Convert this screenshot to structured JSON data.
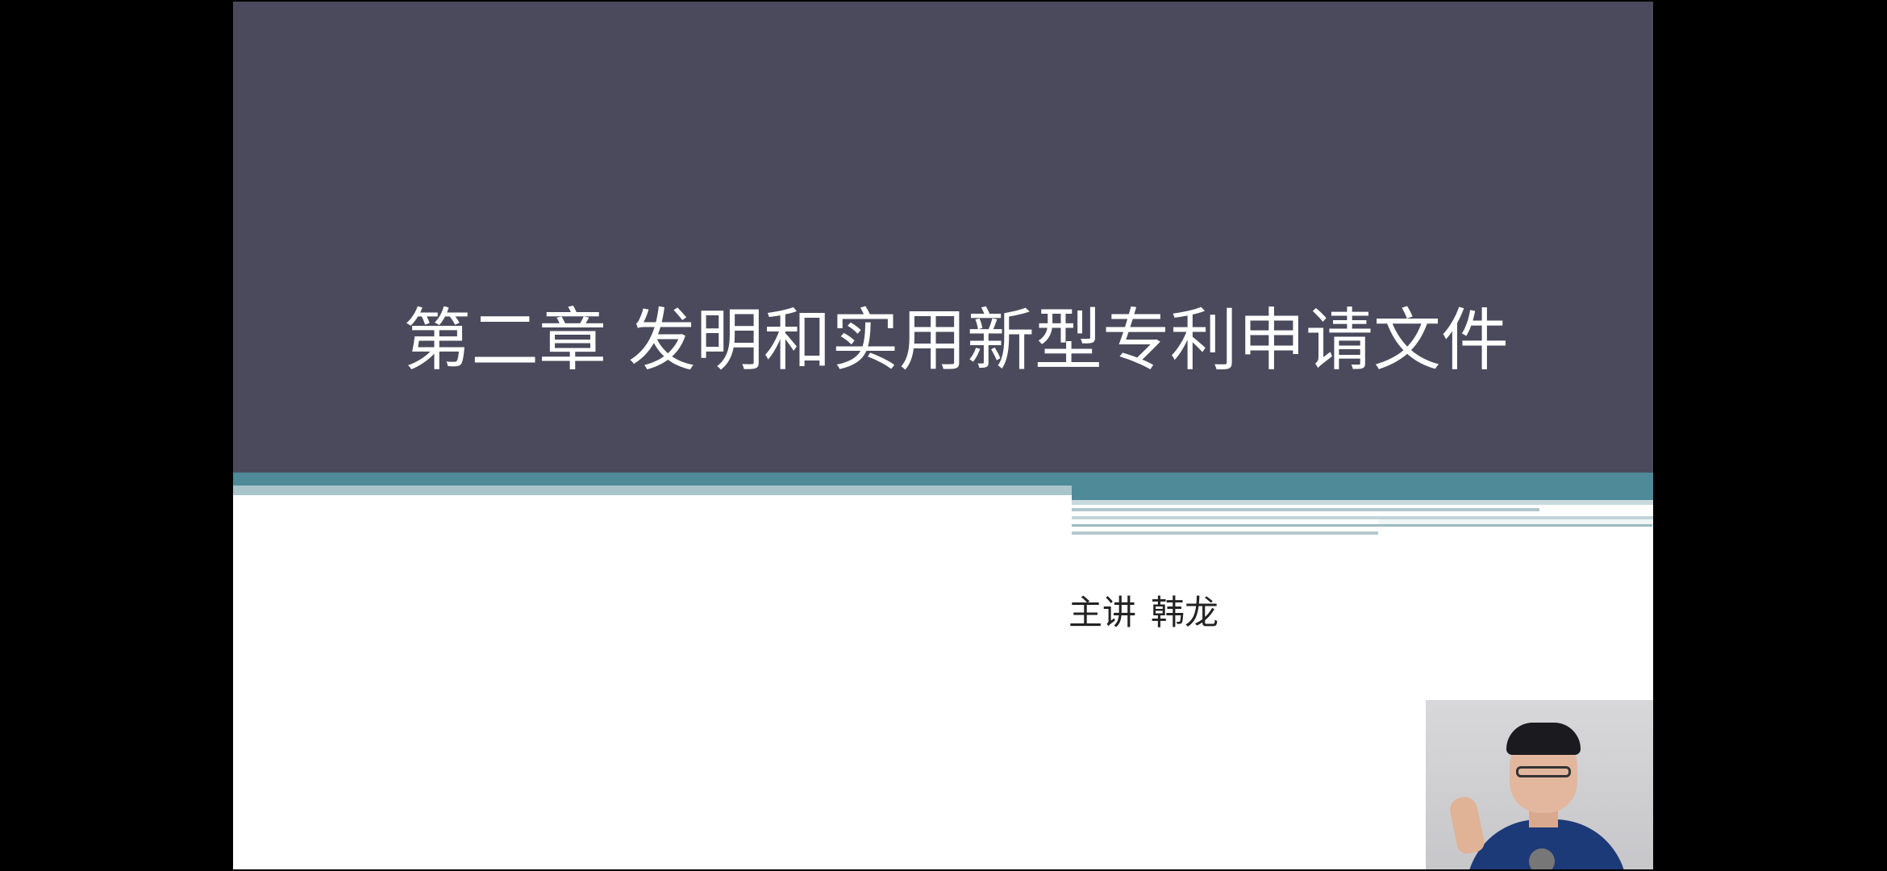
{
  "slide": {
    "title": "第二章 发明和实用新型专利申请文件",
    "presenter_label": "主讲",
    "presenter_name": "韩龙"
  },
  "colors": {
    "title_panel": "#4a4a5c",
    "accent_teal": "#4e8a97",
    "light_stripe": "#a9c4cb",
    "background": "#000000"
  },
  "webcam": {
    "description_icon": "presenter-video-feed"
  }
}
